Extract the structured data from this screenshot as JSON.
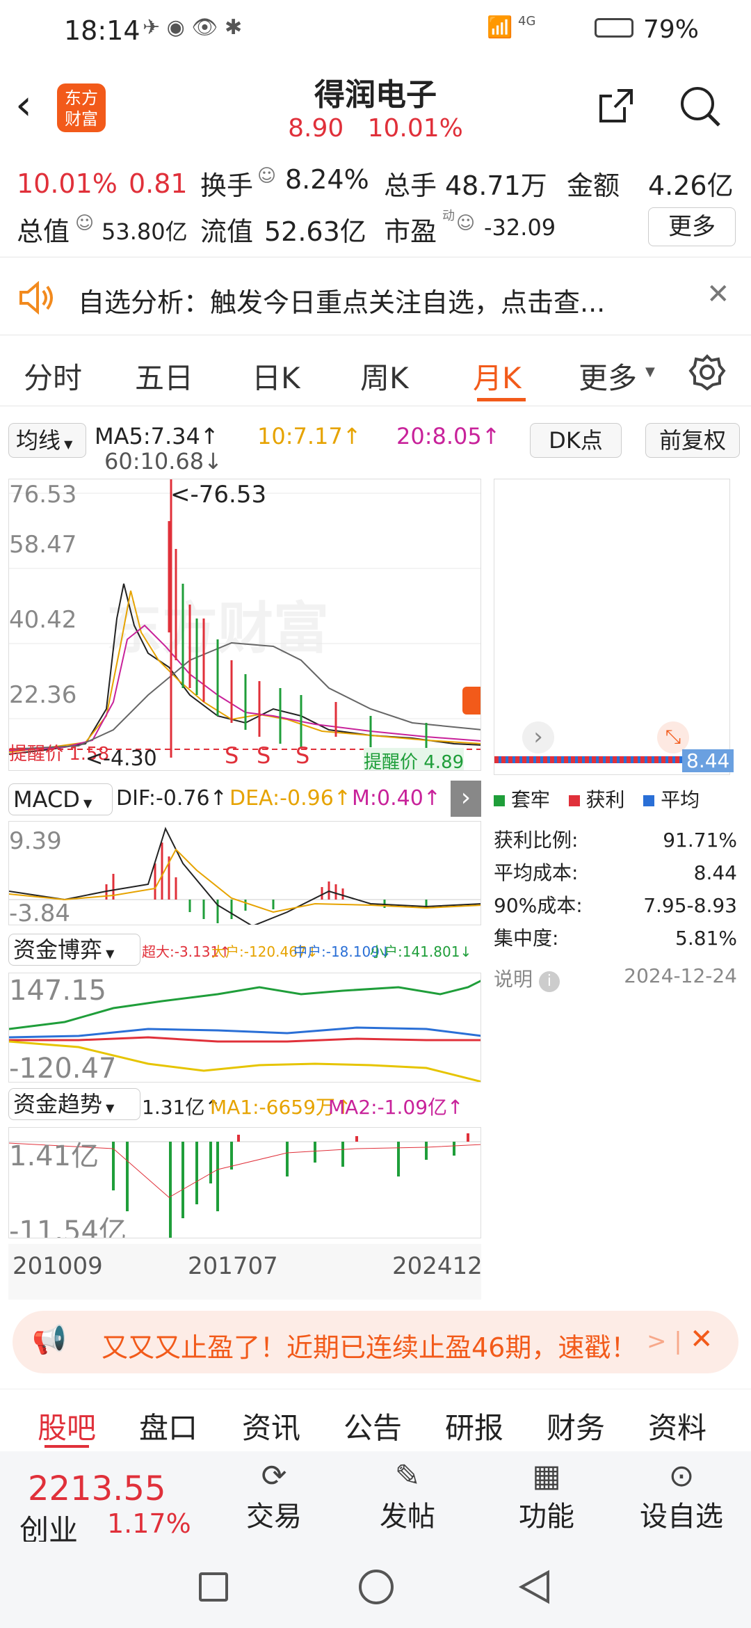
{
  "status": {
    "time": "18:14",
    "net": "4G",
    "battery": "79%"
  },
  "header": {
    "logo_line1": "东方",
    "logo_line2": "财富",
    "title": "得润电子",
    "price": "8.90",
    "change_pct": "10.01%"
  },
  "quote": {
    "pct": "10.01%",
    "chg": "0.81",
    "turnover_label": "换手",
    "turnover": "8.24%",
    "vol_label": "总手",
    "vol": "48.71万",
    "amount_label": "金额",
    "amount": "4.26亿",
    "mcap_label": "总值",
    "mcap": "53.80亿",
    "float_label": "流值",
    "float": "52.63亿",
    "pe_label": "市盈",
    "pe_sup": "动",
    "pe": "-32.09",
    "more": "更多"
  },
  "notice": {
    "text": "自选分析：触发今日重点关注自选，点击查..."
  },
  "tabs": [
    "分时",
    "五日",
    "日K",
    "周K",
    "月K",
    "更多"
  ],
  "active_tab": "月K",
  "ma_row": {
    "selector": "均线",
    "ma5": "MA5:7.34↑",
    "ma10": "10:7.17↑",
    "ma20": "20:8.05↑",
    "ma60": "60:10.68↓",
    "dk": "DK点",
    "fq": "前复权"
  },
  "kline": {
    "watermark": "东方财富",
    "y_labels": [
      "76.53",
      "58.47",
      "40.42",
      "22.36"
    ],
    "max_note": "<-76.53",
    "min_note": "<-4.30",
    "buy_note": "提醒价 4.89",
    "sell_marks": [
      "S",
      "S",
      "S"
    ],
    "alert_left": "提醒价 1.58"
  },
  "chip": {
    "price_tag": "8.44",
    "legend": [
      "套牢",
      "获利",
      "平均"
    ],
    "rows": [
      {
        "k": "获利比例:",
        "v": "91.71%"
      },
      {
        "k": "平均成本:",
        "v": "8.44"
      },
      {
        "k": "90%成本:",
        "v": "7.95-8.93"
      },
      {
        "k": "集中度:",
        "v": "5.81%"
      }
    ],
    "note": "说明",
    "date": "2024-12-24"
  },
  "macd": {
    "selector": "MACD",
    "dif": "DIF:-0.76↑",
    "dea": "DEA:-0.96↑",
    "m": "M:0.40↑",
    "y_top": "9.39",
    "y_bot": "-3.84"
  },
  "fund_game": {
    "selector": "资金博弈",
    "super": "超大:-3.131↑",
    "big": "大户:-120.467↓",
    "mid": "中户:-18.109↓",
    "small": "小户:141.801↓",
    "y_top": "147.15",
    "y_bot": "-120.47"
  },
  "fund_trend": {
    "selector": "资金趋势",
    "val": "1.31亿↑",
    "ma1": "MA1:-6659万↑",
    "ma2": "MA2:-1.09亿↑",
    "y_top": "1.41亿",
    "y_bot": "-11.54亿"
  },
  "x_axis": [
    "201009",
    "201707",
    "202412"
  ],
  "promo": {
    "text": "又又又止盈了！近期已连续止盈46期，速戳！"
  },
  "bottom_tabs": [
    "股吧",
    "盘口",
    "资讯",
    "公告",
    "研报",
    "财务",
    "资料"
  ],
  "footer": {
    "index_value": "2213.55",
    "index_name": "创业",
    "index_pct": "1.17%",
    "trade": "交易",
    "post": "发帖",
    "func": "功能",
    "watch": "设自选"
  },
  "colors": {
    "red": "#e0303a",
    "green": "#1f9e3a",
    "orange": "#f28a1e"
  }
}
